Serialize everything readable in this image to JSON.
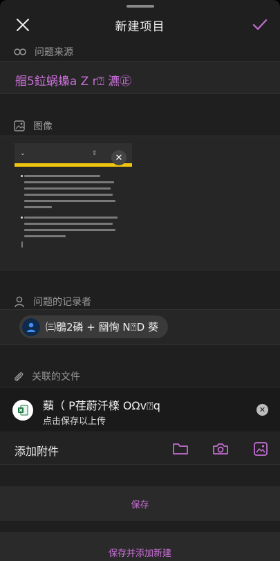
{
  "header": {
    "title": "新建项目",
    "close_icon": "close-icon",
    "confirm_icon": "check-icon"
  },
  "sections": {
    "source_label": "问题来源",
    "source_value": "艒5鉝蜗蟂a Z r⍰ 瀌㊣",
    "image_label": "图像",
    "reporter_label": "问题的记录者",
    "files_label": "关联的文件"
  },
  "reporter": {
    "name": "㈢鶡2磷 + 圝恂 N⍰D 葵"
  },
  "file": {
    "name": "蘱（ P荏蔚汘檪 OΩv⍰q",
    "status": "点击保存以上传"
  },
  "attach": {
    "label": "添加附件"
  },
  "actions": {
    "save": "保存",
    "save_and_new": "保存并添加新建"
  },
  "colors": {
    "accent": "#c76fd6",
    "background": "#1f1f1f",
    "band": "#2a2a2a"
  }
}
